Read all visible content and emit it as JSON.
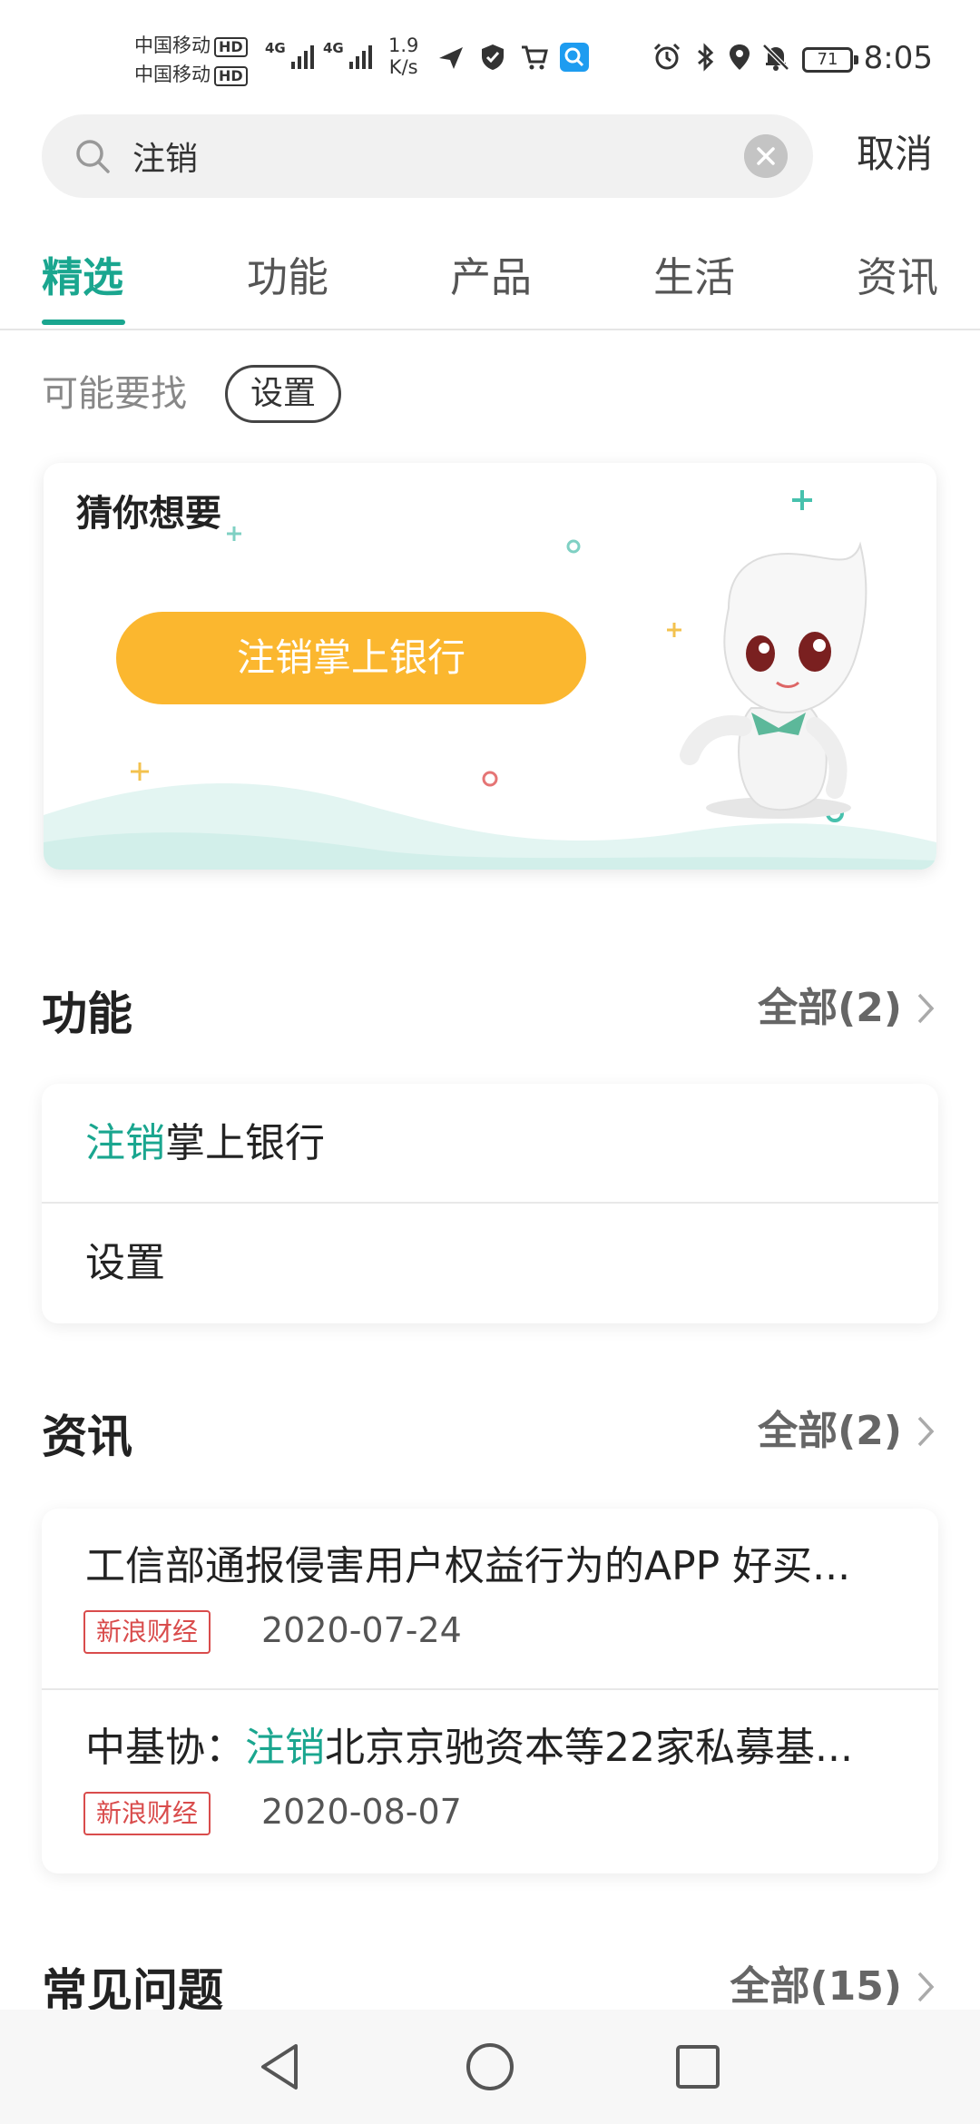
{
  "status_bar": {
    "carrier_1": "中国移动",
    "carrier_2": "中国移动",
    "hd_badge": "HD",
    "network_type": "4G",
    "speed_value": "1.9",
    "speed_unit": "K/s",
    "battery_level": "71",
    "time": "8:05"
  },
  "search": {
    "query": "注销",
    "cancel_label": "取消"
  },
  "tabs": [
    {
      "label": "精选",
      "active": true
    },
    {
      "label": "功能",
      "active": false
    },
    {
      "label": "产品",
      "active": false
    },
    {
      "label": "生活",
      "active": false
    },
    {
      "label": "资讯",
      "active": false
    }
  ],
  "maybe": {
    "label": "可能要找",
    "chip": "设置"
  },
  "guess": {
    "title": "猜你想要",
    "button_label": "注销掌上银行"
  },
  "function_section": {
    "title": "功能",
    "more_label": "全部(2)",
    "items": [
      {
        "highlight": "注销",
        "rest": "掌上银行"
      },
      {
        "highlight": "",
        "rest": "设置"
      }
    ]
  },
  "news_section": {
    "title": "资讯",
    "more_label": "全部(2)",
    "items": [
      {
        "prefix": "工信部通报侵害用户权益行为的APP 好买...",
        "highlight": "",
        "suffix": "",
        "source": "新浪财经",
        "date": "2020-07-24"
      },
      {
        "prefix": "中基协：",
        "highlight": "注销",
        "suffix": "北京京驰资本等22家私募基...",
        "source": "新浪财经",
        "date": "2020-08-07"
      }
    ]
  },
  "faq_section": {
    "title": "常见问题",
    "more_label": "全部(15)"
  },
  "colors": {
    "accent": "#1aa68f",
    "button_yellow": "#fbb72f",
    "source_red": "#d94c4c"
  },
  "icons": {
    "search": "search-icon",
    "clear": "clear-icon",
    "chevron": "chevron-right-icon",
    "nav_back": "back-triangle-icon",
    "nav_home": "home-circle-icon",
    "nav_recent": "recent-square-icon"
  }
}
